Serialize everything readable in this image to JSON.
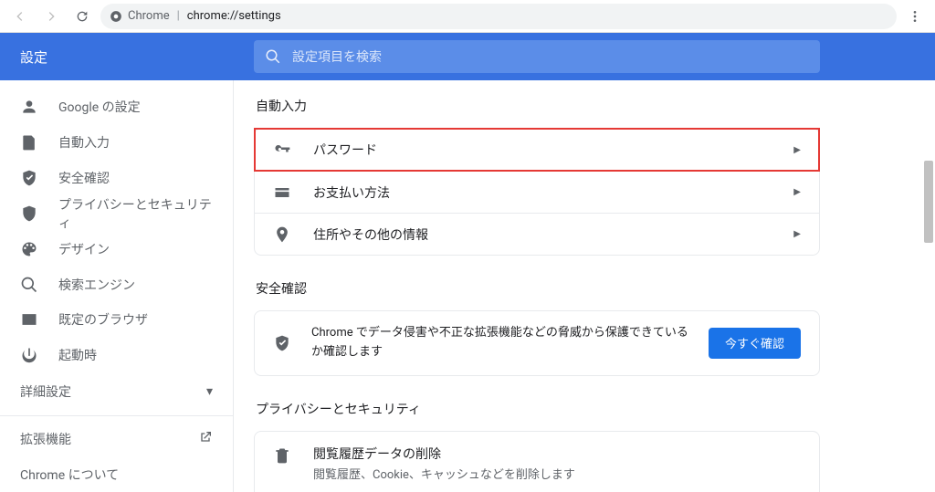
{
  "browser": {
    "back_enabled": false,
    "forward_enabled": false,
    "info_label": "Chrome",
    "url": "chrome://settings"
  },
  "header": {
    "title": "設定",
    "search_placeholder": "設定項目を検索"
  },
  "sidebar": {
    "items": [
      {
        "label": "Google の設定"
      },
      {
        "label": "自動入力"
      },
      {
        "label": "安全確認"
      },
      {
        "label": "プライバシーとセキュリティ"
      },
      {
        "label": "デザイン"
      },
      {
        "label": "検索エンジン"
      },
      {
        "label": "既定のブラウザ"
      },
      {
        "label": "起動時"
      }
    ],
    "advanced_label": "詳細設定",
    "extensions_label": "拡張機能",
    "about_label": "Chrome について"
  },
  "content": {
    "autofill": {
      "title": "自動入力",
      "rows": [
        {
          "label": "パスワード"
        },
        {
          "label": "お支払い方法"
        },
        {
          "label": "住所やその他の情報"
        }
      ]
    },
    "safety": {
      "title": "安全確認",
      "text": "Chrome でデータ侵害や不正な拡張機能などの脅威から保護できているか確認します",
      "button": "今すぐ確認"
    },
    "privacy": {
      "title": "プライバシーとセキュリティ",
      "row_title": "閲覧履歴データの削除",
      "row_sub": "閲覧履歴、Cookie、キャッシュなどを削除します"
    }
  }
}
